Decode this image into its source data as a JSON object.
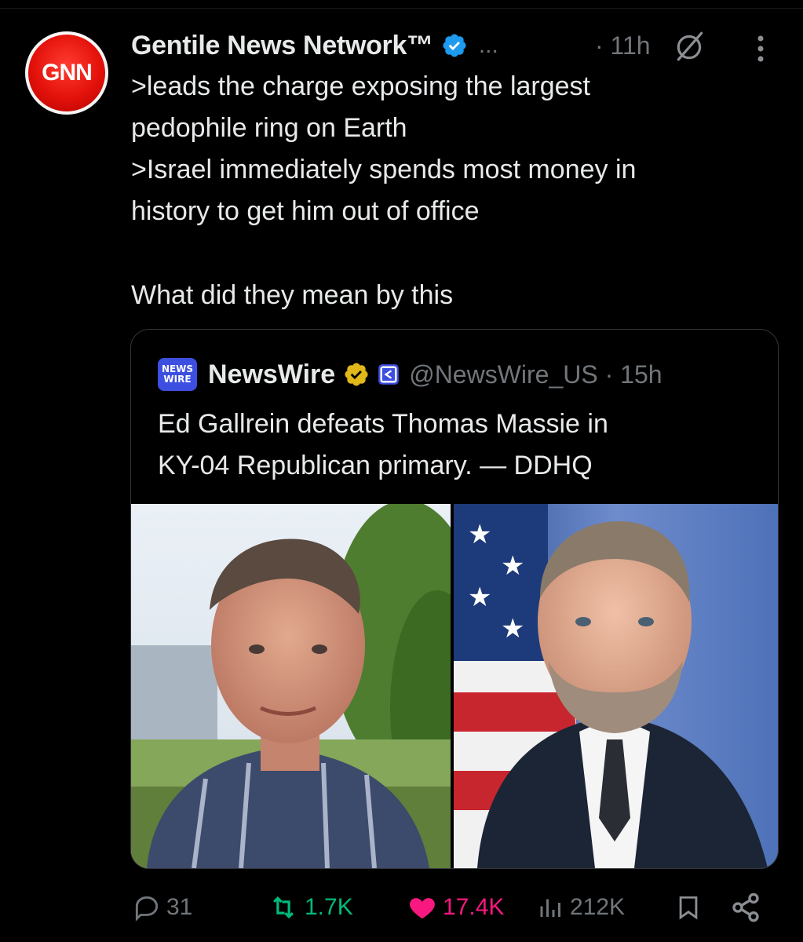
{
  "post": {
    "avatar_text": "GNN",
    "author_name": "Gentile News Network™",
    "more_dots": "...",
    "time": "· 11h",
    "text_lines": [
      ">leads the charge exposing the largest",
      "pedophile ring on Earth",
      ">Israel immediately spends most money in",
      "history to get him out of office",
      "What did they mean by this"
    ]
  },
  "quote": {
    "logo_line1": "NEWS",
    "logo_line2": "WIRE",
    "name": "NewsWire",
    "handle_time": "@NewsWire_US · 15h",
    "text_lines": [
      "Ed Gallrein defeats Thomas Massie in",
      "KY-04 Republican primary. — DDHQ"
    ]
  },
  "actions": {
    "replies": "31",
    "reposts": "1.7K",
    "likes": "17.4K",
    "views": "212K"
  },
  "colors": {
    "background": "#000000",
    "verified_blue": "#1d9bf0",
    "verified_gold": "#e2b719",
    "repost_green": "#00ba7c",
    "like_pink": "#f91880",
    "muted_gray": "#71767b"
  }
}
